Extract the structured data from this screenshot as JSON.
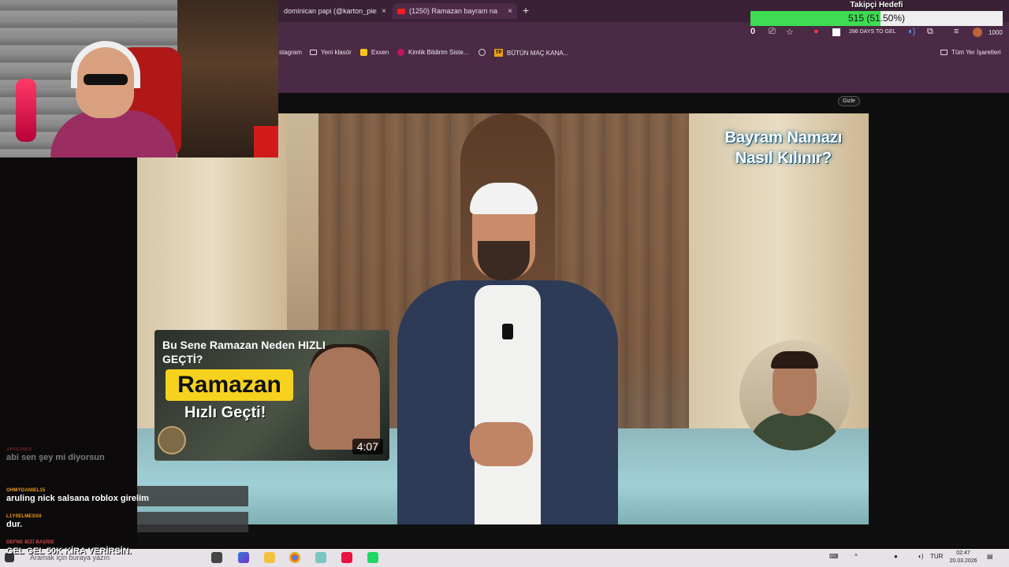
{
  "browser": {
    "tabs": [
      {
        "label": "dominican papi (@karton_pier",
        "close": "×"
      },
      {
        "label": "(1250) Ramazan bayram na",
        "close": "×"
      }
    ],
    "new_tab": "+",
    "toolbar_count": "0",
    "extension_text": "286 DAYS TO GEL",
    "extension_count": "1000",
    "bookmarks": [
      {
        "label": "stagram"
      },
      {
        "label": "Yeni klasör",
        "icon": "folder-icon"
      },
      {
        "label": "Exxen",
        "icon": "exxen-icon"
      },
      {
        "label": "Kimlik Bildirim Siste...",
        "icon": "kimlik-icon"
      },
      {
        "label": "",
        "icon": "globe-icon"
      },
      {
        "label": "BÜTÜN MAÇ KANA...",
        "icon": "tp-icon",
        "icon_text": "TP"
      }
    ],
    "all_bookmarks": "Tüm Yer İşaretleri"
  },
  "video": {
    "title_line1": "Bayram Namazı",
    "title_line2": "Nasıl Kılınır?",
    "hide_button": "Gizle",
    "endcard": {
      "title": "Bu Sene Ramazan Neden HIZLI GEÇTİ?",
      "badge": "Ramazan",
      "subtitle": "Hızlı Geçti!",
      "duration": "4:07"
    }
  },
  "follow_goal": {
    "title": "Takipçi Hedefi",
    "value_text": "515 (51.50%)",
    "progress": 0.515,
    "fill_color": "#3ddc53"
  },
  "chat": [
    {
      "user": "ARULINES",
      "text": "abi sen şey mi diyorsun",
      "color": "#d64a4a",
      "faded": true
    },
    {
      "user": "OHMYDANIEL15",
      "text": "aruling nick salsana roblox girelim",
      "color": "#f0a020"
    },
    {
      "user": "L1Y0ELMESSII",
      "text": "dur.",
      "color": "#f0a020"
    },
    {
      "user": "DEFNE BİZİ BAŞİDE",
      "text": "",
      "color": "#d64a4a"
    }
  ],
  "banner": "GEL GEL 50K KİRA VERİRSİN.",
  "taskbar": {
    "search_placeholder": "Aramak için buraya yazın",
    "language": "TUR",
    "time": "02:47",
    "date": "20.03.2026"
  }
}
